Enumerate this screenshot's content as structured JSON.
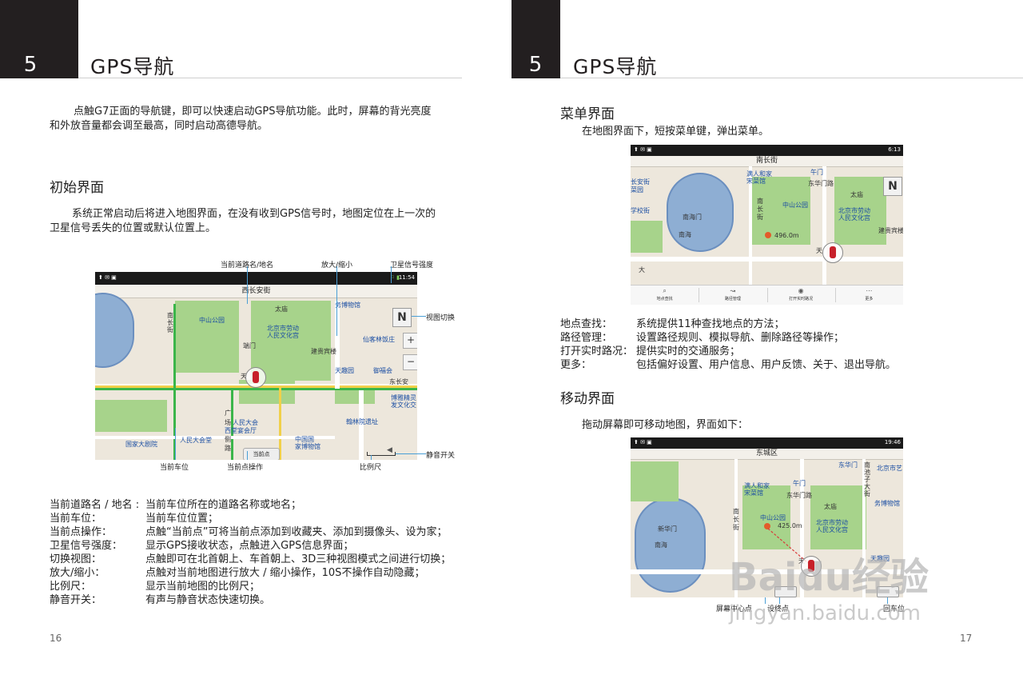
{
  "left_page": {
    "chapter_number": "5",
    "chapter_title": "GPS导航",
    "intro_line1": "点触G7正面的导航键，即可以快速启动GPS导航功能。此时，屏幕的背光亮度",
    "intro_line2": "和外放音量都会调至最高，同时启动高德导航。",
    "section_title": "初始界面",
    "section_line1": "系统正常启动后将进入地图界面，在没有收到GPS信号时，地图定位在上一次的",
    "section_line2": "卫星信号丢失的位置或默认位置上。",
    "callouts": {
      "road_name": "当前道路名/地名",
      "zoom": "放大/缩小",
      "gps_strength": "卫星信号强度",
      "view_switch": "视图切换",
      "mute": "静音开关",
      "car_position": "当前车位",
      "current_point_op": "当前点操作",
      "scale": "比例尺"
    },
    "map1": {
      "road_bar": "西长安街",
      "time": "11:54",
      "compass": "N",
      "current_point_button": "当前点",
      "labels": {
        "nanchangjie": "南长街",
        "zhongshan": "中山公园",
        "taimiao": "太庙",
        "bowuguan": "务博物馆",
        "laodong": "北京市劳动",
        "wenhua": "人民文化宫",
        "duanmen": "端门",
        "xianjian": "仙客林饭庄",
        "guibin": "建贵宾楼",
        "tian": "天",
        "tianqu": "天趣园",
        "yufu": "御福会",
        "dongchangan": "东长安",
        "boya": "博雅精灵",
        "fawen": "发文化交",
        "guang": "广",
        "chang": "场",
        "dahui": "人民大会",
        "xitang": "西堂宴会厅",
        "ce": "侧",
        "lu": "路",
        "hanlin": "翰林院遗址",
        "dajuyuan": "国家大剧院",
        "dahuitang": "人民大会堂",
        "guoguo": "中国国",
        "guobowu": "家博物馆"
      }
    },
    "desc": [
      {
        "k": "当前道路名 / 地名 :",
        "v": "当前车位所在的道路名称或地名；"
      },
      {
        "k": "当前车位：",
        "v": "当前车位位置；"
      },
      {
        "k": "当前点操作：",
        "v": "点触“当前点”可将当前点添加到收藏夹、添加到摄像头、设为家；"
      },
      {
        "k": "卫星信号强度：",
        "v": "显示GPS接收状态，点触进入GPS信息界面；"
      },
      {
        "k": "切换视图：",
        "v": "点触即可在北首朝上、车首朝上、3D三种视图模式之间进行切换；"
      },
      {
        "k": "放大/缩小：",
        "v": "点触对当前地图进行放大 / 缩小操作，10S不操作自动隐藏；"
      },
      {
        "k": "比例尺：",
        "v": "显示当前地图的比例尺；"
      },
      {
        "k": "静音开关：",
        "v": "有声与静音状态快速切换。"
      }
    ],
    "page_number": "16"
  },
  "right_page": {
    "chapter_number": "5",
    "chapter_title": "GPS导航",
    "menu_section_title": "菜单界面",
    "menu_section_line": "在地图界面下，短按菜单键，弹出菜单。",
    "map2": {
      "road_bar": "南长街",
      "time": "6:13",
      "compass": "N",
      "distance": "496.0m",
      "menu_items": [
        "地点查找",
        "路径管理",
        "打开实时路况",
        "更多"
      ],
      "labels": {
        "wumen": "午门",
        "duanmen": "满人和家",
        "song": "宋菜馆",
        "changan": "长安街",
        "cai": "菜园",
        "dongmen": "东华门路",
        "taimiao": "太庙",
        "nanchang": "南",
        "chang": "长",
        "jie": "街",
        "zhongshan": "中山公园",
        "laodong": "北京市劳动",
        "wenhua": "人民文化宫",
        "xuexiao": "学校街",
        "nanhaimen": "南海门",
        "nanhai": "南海",
        "guibin": "建贵宾楼",
        "tian": "天",
        "da": "大"
      }
    },
    "features": [
      {
        "k": "地点查找：",
        "v": "系统提供11种查找地点的方法；"
      },
      {
        "k": "路径管理：",
        "v": "设置路径规则、模拟导航、删除路径等操作；"
      },
      {
        "k": "打开实时路况：",
        "v": "提供实时的交通服务；"
      },
      {
        "k": "更多：",
        "v": "包括偏好设置、用户信息、用户反馈、关于、退出导航。"
      }
    ],
    "move_section_title": "移动界面",
    "move_section_line": "拖动屏幕即可移动地图，界面如下：",
    "map3": {
      "road_bar": "东城区",
      "time": "19:46",
      "distance": "425.0m",
      "labels": {
        "wumen": "午门",
        "donghuamen": "东华门路",
        "manren": "满人和家",
        "song": "宋菜馆",
        "taimiao": "太庙",
        "nan": "南",
        "chang": "长",
        "jie": "街",
        "zhongshan": "中山公园",
        "laodong": "北京市劳动",
        "wenhua": "人民文化宫",
        "xinhua": "新华门",
        "nanhai": "南海",
        "tian": "天",
        "tianqu": "天趣园",
        "dongchizi": "南池子大街",
        "yishu": "北京市艺",
        "wuguan": "务博物馆"
      }
    },
    "callouts": {
      "screen_center": "屏幕中心点",
      "set_end": "设终点",
      "return_car": "回车位"
    },
    "page_number": "17"
  },
  "watermark": {
    "brand": "Baidu经验",
    "url": "jingyan.baidu.com"
  },
  "colors": {
    "chapter_block": "#231f20",
    "park": "#a7d38b",
    "lake": "#8eaed3",
    "callout_line": "#4a9fd6",
    "route_green": "#3bb54a",
    "route_yellow": "#f1d04a"
  }
}
